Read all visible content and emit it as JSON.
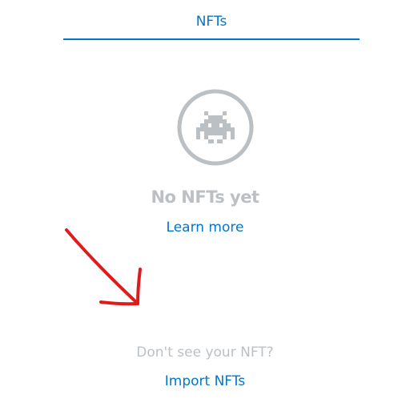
{
  "tabs": {
    "active_label": "NFTs"
  },
  "empty_state": {
    "icon": "space-invader-icon",
    "title": "No NFTs yet",
    "learn_more": "Learn more"
  },
  "import": {
    "prompt": "Don't see your NFT?",
    "link": "Import NFTs"
  },
  "colors": {
    "accent": "#0376c9",
    "muted": "#bbc0c5",
    "annotation": "#e01b1b"
  }
}
